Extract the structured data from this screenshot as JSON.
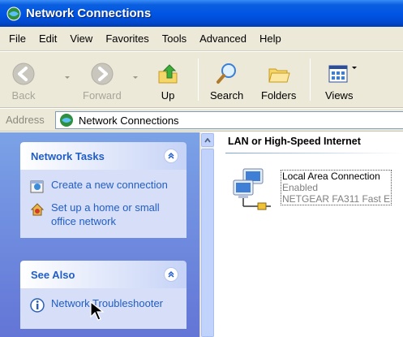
{
  "window": {
    "title": "Network Connections"
  },
  "menu": [
    "File",
    "Edit",
    "View",
    "Favorites",
    "Tools",
    "Advanced",
    "Help"
  ],
  "toolbar": {
    "back": "Back",
    "forward": "Forward",
    "up": "Up",
    "search": "Search",
    "folders": "Folders",
    "views": "Views"
  },
  "address": {
    "label": "Address",
    "value": "Network Connections"
  },
  "task_pane": {
    "network_tasks": {
      "title": "Network Tasks",
      "items": [
        {
          "label": "Create a new connection",
          "icon": "new-connection-icon"
        },
        {
          "label": "Set up a home or small office network",
          "icon": "home-network-icon"
        }
      ]
    },
    "see_also": {
      "title": "See Also",
      "items": [
        {
          "label": "Network Troubleshooter",
          "icon": "info-icon"
        }
      ]
    }
  },
  "content": {
    "group_title": "LAN or High-Speed Internet",
    "connections": [
      {
        "name": "Local Area Connection",
        "status": "Enabled",
        "device": "NETGEAR FA311 Fast E"
      }
    ]
  },
  "colors": {
    "titlebar": "#0054e3",
    "task_link": "#215dc6",
    "task_pane_bg": "#7ba2e7",
    "panel_body": "#d6dff7"
  }
}
